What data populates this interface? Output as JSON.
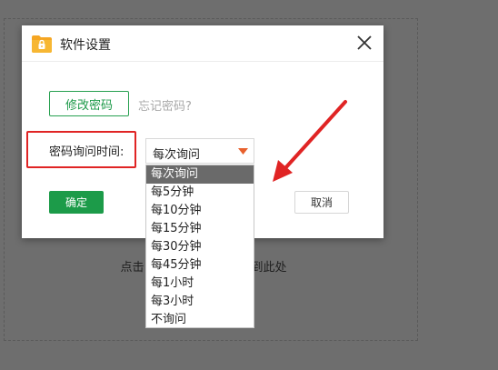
{
  "background": {
    "hint_left": "点击",
    "hint_right": "到此处"
  },
  "dialog": {
    "title": "软件设置",
    "icon": "folder-lock-icon",
    "close_icon": "close-icon",
    "change_password_label": "修改密码",
    "forgot_password_label": "忘记密码?",
    "ask_time_label": "密码询问时间:",
    "select_value": "每次询问",
    "ok_label": "确定",
    "cancel_label": "取消"
  },
  "dropdown": {
    "options": [
      "每次询问",
      "每5分钟",
      "每10分钟",
      "每15分钟",
      "每30分钟",
      "每45分钟",
      "每1小时",
      "每3小时",
      "不询问"
    ],
    "selected_index": 0
  },
  "colors": {
    "accent_green": "#1c9b49",
    "highlight_red": "#e02424",
    "select_arrow_orange": "#e8602c"
  }
}
